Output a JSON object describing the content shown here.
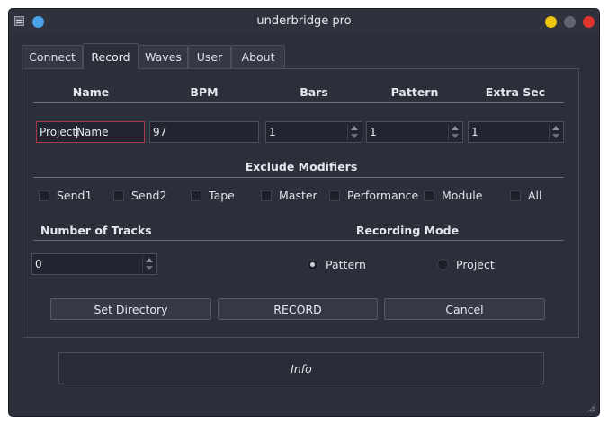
{
  "window": {
    "title": "underbridge pro"
  },
  "tabs": [
    {
      "label": "Connect"
    },
    {
      "label": "Record"
    },
    {
      "label": "Waves"
    },
    {
      "label": "User"
    },
    {
      "label": "About"
    }
  ],
  "record": {
    "headers": {
      "name": "Name",
      "bpm": "BPM",
      "bars": "Bars",
      "pattern": "Pattern",
      "extra_sec": "Extra Sec"
    },
    "name_value_a": "Project ",
    "name_value_b": "Name",
    "bpm_value": "97",
    "bars_value": "1",
    "pattern_value": "1",
    "extra_sec_value": "1",
    "exclude_title": "Exclude Modifiers",
    "modifiers": [
      "Send1",
      "Send2",
      "Tape",
      "Master",
      "Performance",
      "Module",
      "All"
    ],
    "tracks_title": "Number of Tracks",
    "tracks_value": "0",
    "mode_title": "Recording Mode",
    "modes": [
      {
        "label": "Pattern",
        "checked": true
      },
      {
        "label": "Project",
        "checked": false
      }
    ],
    "buttons": {
      "set_directory": "Set Directory",
      "record": "RECORD",
      "cancel": "Cancel"
    }
  },
  "info": {
    "label": "Info"
  },
  "colors": {
    "window_bg": "#2c2f3a",
    "focus_border": "#a83a4c",
    "close": "#e0342f",
    "minimize": "#f1c40f",
    "pin": "#4aa3e8"
  }
}
